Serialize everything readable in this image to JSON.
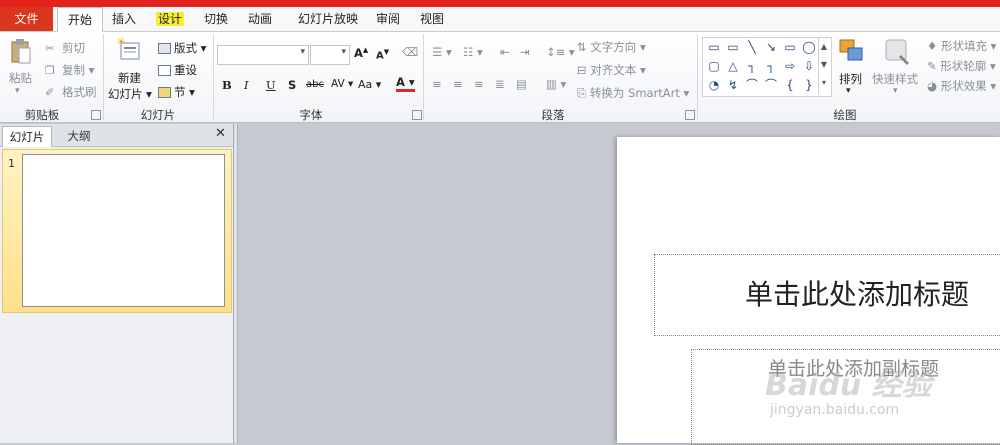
{
  "tabs": [
    "文件",
    "开始",
    "插入",
    "设计",
    "切换",
    "动画",
    "幻灯片放映",
    "审阅",
    "视图"
  ],
  "ribbon": {
    "clipboard": {
      "label": "剪贴板",
      "paste": "粘贴",
      "cut": "剪切",
      "copy": "复制",
      "format_painter": "格式刷"
    },
    "slides": {
      "label": "幻灯片",
      "new_slide_line1": "新建",
      "new_slide_line2": "幻灯片",
      "layout": "版式",
      "reset": "重设",
      "section": "节"
    },
    "font": {
      "label": "字体",
      "grow": "A",
      "shrink": "A",
      "bold": "B",
      "italic": "I",
      "underline": "U",
      "shadow": "S",
      "strike": "abc",
      "spacing": "AV",
      "case": "Aa",
      "color": "A"
    },
    "paragraph": {
      "label": "段落",
      "text_direction": "文字方向",
      "align_text": "对齐文本",
      "smartart": "转换为 SmartArt"
    },
    "drawing": {
      "label": "绘图",
      "arrange": "排列",
      "quick_styles": "快速样式",
      "shape_fill": "形状填充",
      "shape_outline": "形状轮廓",
      "shape_effects": "形状效果",
      "shapes": [
        "▭",
        "▭",
        "╲",
        "↘",
        "▭",
        "◯",
        "▢",
        "△",
        "┐",
        "┐",
        "⇨",
        "⇩",
        "◔",
        "↯",
        "⌒",
        "⌒",
        "{",
        "}"
      ]
    }
  },
  "panel": {
    "tab_slides": "幻灯片",
    "tab_outline": "大纲",
    "close": "✕",
    "slide_number": "1"
  },
  "slide": {
    "title_placeholder": "单击此处添加标题",
    "subtitle_placeholder": "单击此处添加副标题"
  },
  "watermark": {
    "logo": "Baidu 经验",
    "url": "jingyan.baidu.com"
  },
  "colors": {
    "file_tab": "#d9371c",
    "top_bar": "#e3231b",
    "design_highlight": "#f6f035",
    "slide_selection": "#ffe08a"
  }
}
